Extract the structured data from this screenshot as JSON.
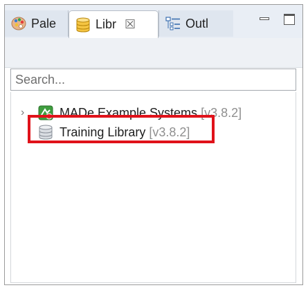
{
  "tabs": [
    {
      "label": "Pale",
      "icon": "palette-icon"
    },
    {
      "label": "Libr",
      "icon": "library-database-icon",
      "close": "☒"
    },
    {
      "label": "Outl",
      "icon": "outline-icon"
    }
  ],
  "search": {
    "placeholder": "Search..."
  },
  "tree": {
    "items": [
      {
        "label": "MADe Example Systems",
        "version": "[v3.8.2]",
        "icon": "example-systems-icon",
        "expander": "›"
      },
      {
        "label": "Training Library",
        "version": "[v3.8.2]",
        "icon": "database-icon"
      }
    ]
  },
  "colors": {
    "highlight": "#e0121a",
    "tab_bg": "#dfe6ef",
    "active_tab": "#ffffff"
  }
}
